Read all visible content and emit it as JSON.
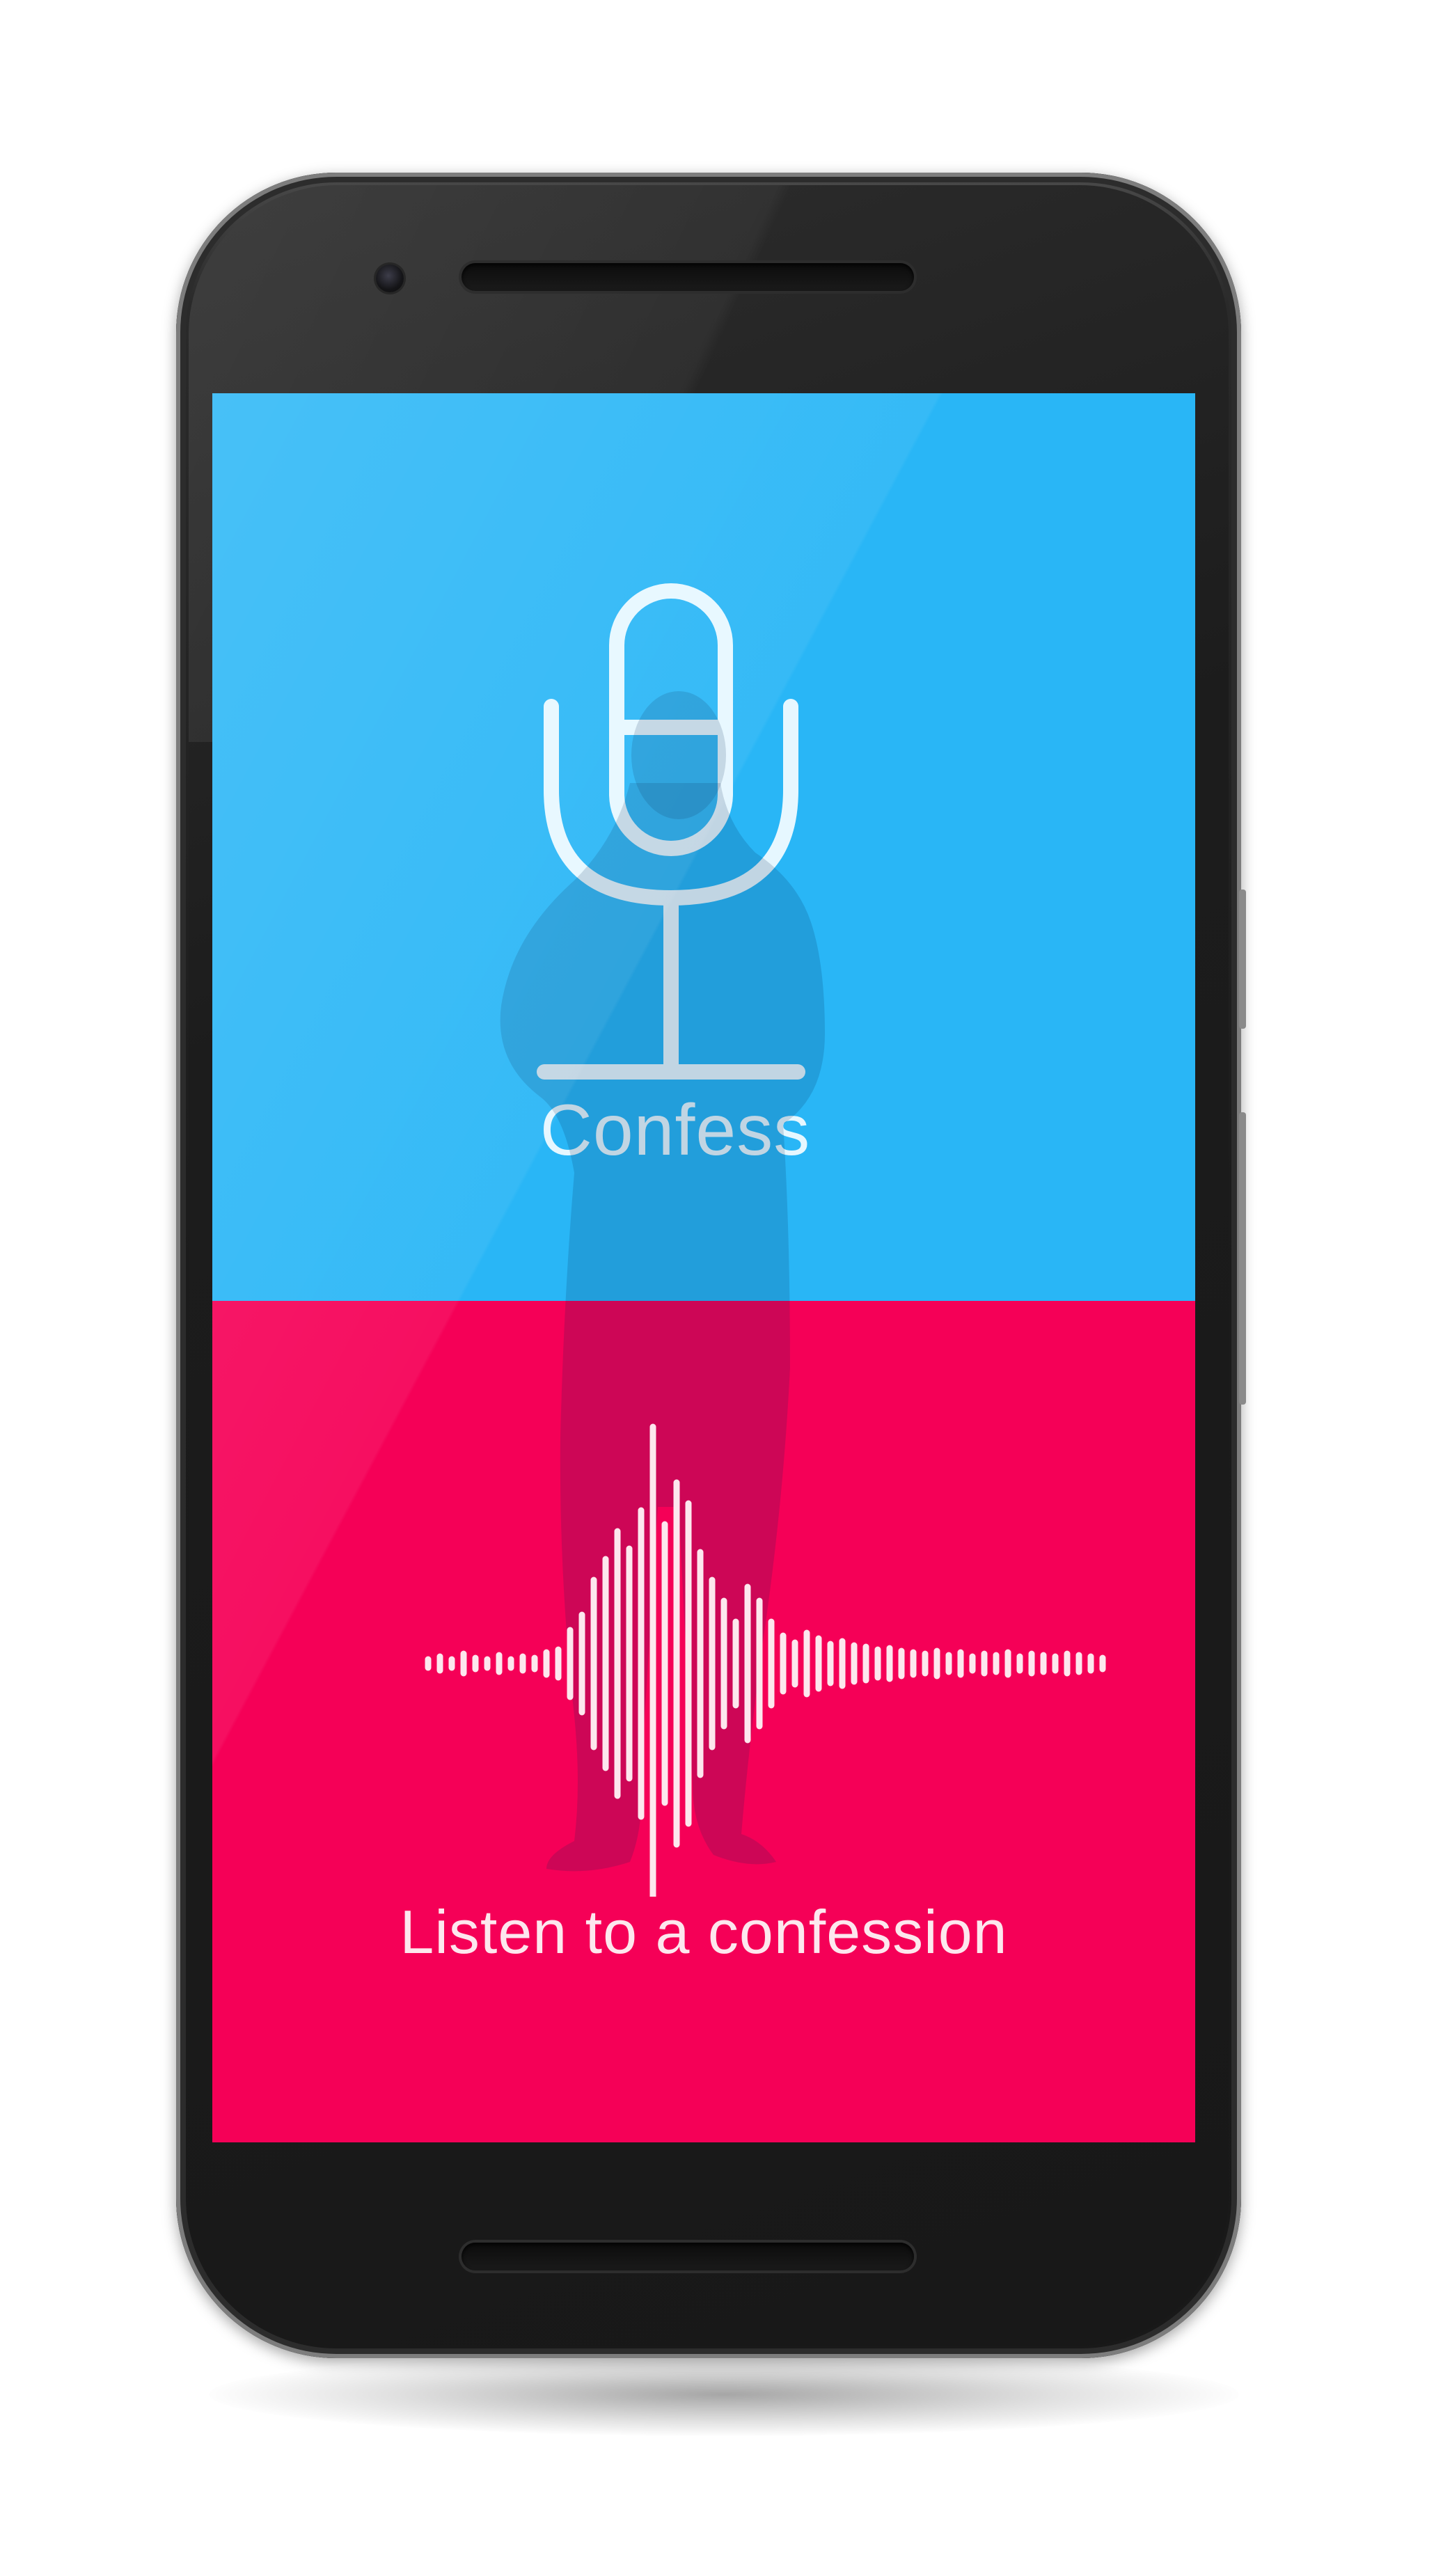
{
  "app": {
    "confess_label": "Confess",
    "listen_label": "Listen to a confession"
  },
  "colors": {
    "confess_panel": "#29b6f6",
    "listen_panel": "#f50057",
    "icon_stroke": "#e6f7ff",
    "phone_body": "#1b1b1b"
  },
  "icons": {
    "confess": "microphone-icon",
    "listen": "waveform-icon"
  }
}
